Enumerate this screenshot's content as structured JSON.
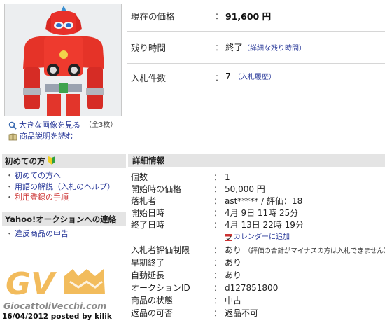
{
  "item_image": {
    "view_large": "大きな画像を見る",
    "view_large_note": "（全3枚）",
    "description_link": "商品説明を読む"
  },
  "sidebar": {
    "first_time": {
      "heading": "初めての方",
      "links": [
        {
          "label": "初めての方へ"
        },
        {
          "label": "用語の解説（入札のヘルプ）"
        },
        {
          "label": "利用登録の手順"
        }
      ]
    },
    "contact": {
      "heading": "Yahoo!オークションへの連絡",
      "links": [
        {
          "label": "違反商品の申告"
        }
      ]
    }
  },
  "summary": {
    "price_label": "現在の価格",
    "price_value": "91,600 円",
    "time_label": "残り時間",
    "time_value": "終了",
    "time_link": "（詳細な残り時間）",
    "bids_label": "入札件数",
    "bids_value": "7",
    "bids_link": "（入札履歴）",
    "colon": "："
  },
  "details": {
    "heading": "詳細情報",
    "rows": [
      {
        "key": "個数",
        "value": "1"
      },
      {
        "key": "開始時の価格",
        "value": "50,000 円"
      },
      {
        "key": "落札者",
        "value": "ast***** / 評価：18"
      },
      {
        "key": "開始日時",
        "value": "4月 9日 11時 25分"
      },
      {
        "key": "終了日時",
        "value": "4月 13日 22時 19分"
      },
      {
        "key": "",
        "value": "カレンダーに追加"
      },
      {
        "key": "入札者評価制限",
        "value": "あり",
        "sub": "（評価の合計がマイナスの方は入札できません）"
      },
      {
        "key": "早期終了",
        "value": "あり"
      },
      {
        "key": "自動延長",
        "value": "あり"
      },
      {
        "key": "オークションID",
        "value": "d127851800"
      },
      {
        "key": "商品の状態",
        "value": "中古"
      },
      {
        "key": "返品の可否",
        "value": "返品不可"
      }
    ]
  },
  "watermark": {
    "logo_letters": "GV",
    "site": "GiocattoliVecchi.com",
    "posted": "16/04/2012 posted by kilik"
  },
  "colors": {
    "link": "#2a3a9a",
    "section_bg": "#e4e4e4",
    "logo_orange": "#f0b040"
  }
}
